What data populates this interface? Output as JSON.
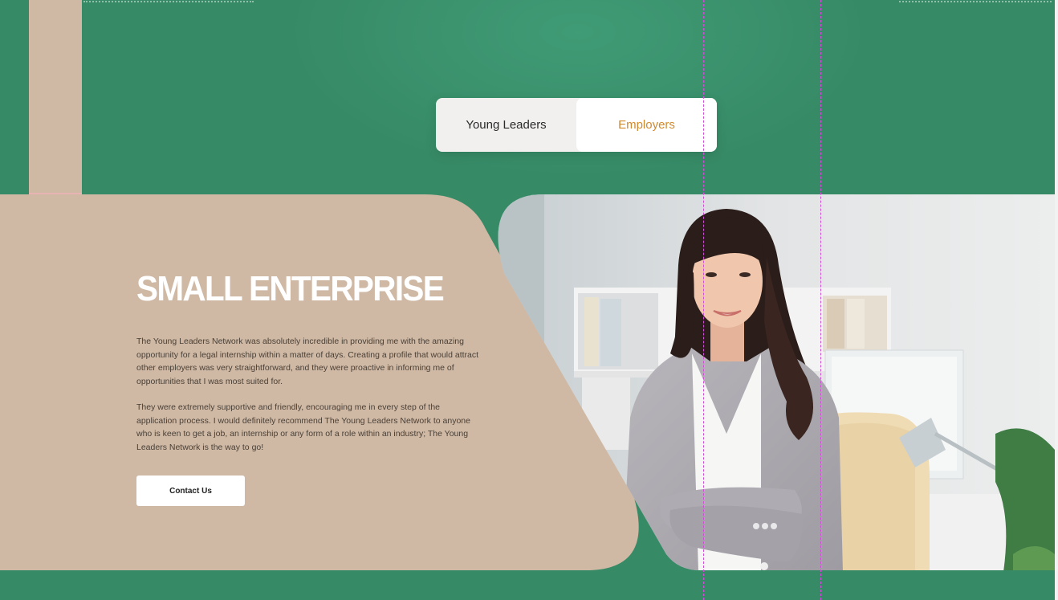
{
  "toggle": {
    "young_leaders_label": "Young Leaders",
    "employers_label": "Employers",
    "selected": "Employers"
  },
  "hero": {
    "title": "SMALL ENTERPRISE",
    "paragraph_1": "The Young Leaders Network was absolutely incredible in providing me with the amazing opportunity for a legal internship within a matter of days. Creating a profile that would attract other employers was very straightforward, and they were proactive in informing me of opportunities that I was most suited for.",
    "paragraph_2": "They were extremely supportive and friendly, encouraging me in every step of the application process. I would definitely recommend The Young Leaders Network to anyone who is keen to get a job, an internship or any form of a role within an industry; The Young Leaders Network is the way to go!",
    "cta_label": "Contact Us"
  },
  "photo": {
    "subject": "smiling woman in grey blazer with arms crossed in office"
  },
  "colors": {
    "background_green": "#378a66",
    "card_beige": "#cfb9a5",
    "accent_orange": "#d08a2e",
    "title_white": "#ffffff",
    "guide_magenta": "#d14bd8"
  }
}
